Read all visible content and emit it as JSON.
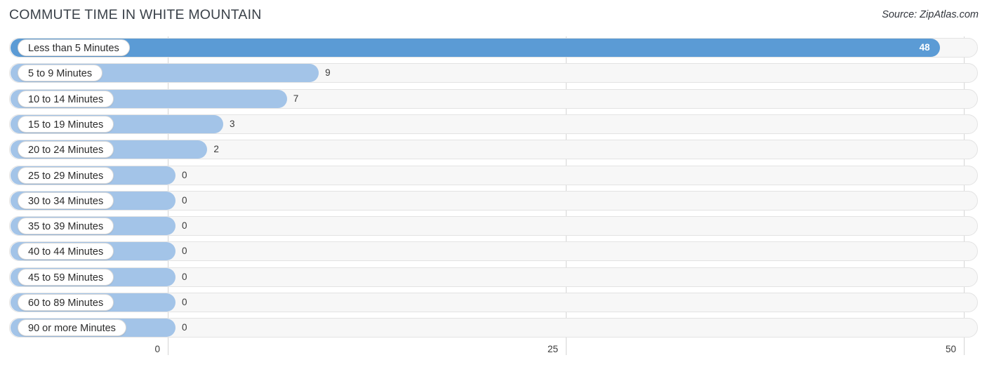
{
  "header": {
    "title": "COMMUTE TIME IN WHITE MOUNTAIN",
    "source": "Source: ZipAtlas.com"
  },
  "colors": {
    "bar_light": "#a3c4e8",
    "bar_strong": "#5b9bd5",
    "track": "#f7f7f7",
    "track_border": "#e3e3e3",
    "gridline": "#d5d5d5",
    "title_text": "#3a4149",
    "value_text": "#3a3a3a",
    "value_text_inside": "#ffffff"
  },
  "chart_data": {
    "type": "bar",
    "orientation": "horizontal",
    "title": "COMMUTE TIME IN WHITE MOUNTAIN",
    "xlabel": "",
    "ylabel": "",
    "xlim": [
      0,
      50
    ],
    "grid": true,
    "legend": null,
    "xticks": [
      "0",
      "25",
      "50"
    ],
    "xtick_values": [
      0,
      25,
      50
    ],
    "categories": [
      "Less than 5 Minutes",
      "5 to 9 Minutes",
      "10 to 14 Minutes",
      "15 to 19 Minutes",
      "20 to 24 Minutes",
      "25 to 29 Minutes",
      "30 to 34 Minutes",
      "35 to 39 Minutes",
      "40 to 44 Minutes",
      "45 to 59 Minutes",
      "60 to 89 Minutes",
      "90 or more Minutes"
    ],
    "values": [
      48,
      9,
      7,
      3,
      2,
      0,
      0,
      0,
      0,
      0,
      0,
      0
    ],
    "value_labels": [
      "48",
      "9",
      "7",
      "3",
      "2",
      "0",
      "0",
      "0",
      "0",
      "0",
      "0",
      "0"
    ]
  },
  "rows": [
    {
      "label": "Less than 5 Minutes",
      "value": 48,
      "value_label": "48",
      "inside": true
    },
    {
      "label": "5 to 9 Minutes",
      "value": 9,
      "value_label": "9",
      "inside": false
    },
    {
      "label": "10 to 14 Minutes",
      "value": 7,
      "value_label": "7",
      "inside": false
    },
    {
      "label": "15 to 19 Minutes",
      "value": 3,
      "value_label": "3",
      "inside": false
    },
    {
      "label": "20 to 24 Minutes",
      "value": 2,
      "value_label": "2",
      "inside": false
    },
    {
      "label": "25 to 29 Minutes",
      "value": 0,
      "value_label": "0",
      "inside": false
    },
    {
      "label": "30 to 34 Minutes",
      "value": 0,
      "value_label": "0",
      "inside": false
    },
    {
      "label": "35 to 39 Minutes",
      "value": 0,
      "value_label": "0",
      "inside": false
    },
    {
      "label": "40 to 44 Minutes",
      "value": 0,
      "value_label": "0",
      "inside": false
    },
    {
      "label": "45 to 59 Minutes",
      "value": 0,
      "value_label": "0",
      "inside": false
    },
    {
      "label": "60 to 89 Minutes",
      "value": 0,
      "value_label": "0",
      "inside": false
    },
    {
      "label": "90 or more Minutes",
      "value": 0,
      "value_label": "0",
      "inside": false
    }
  ],
  "axis": {
    "ticks": [
      {
        "label": "0",
        "value": 0
      },
      {
        "label": "25",
        "value": 25
      },
      {
        "label": "50",
        "value": 50
      }
    ]
  }
}
